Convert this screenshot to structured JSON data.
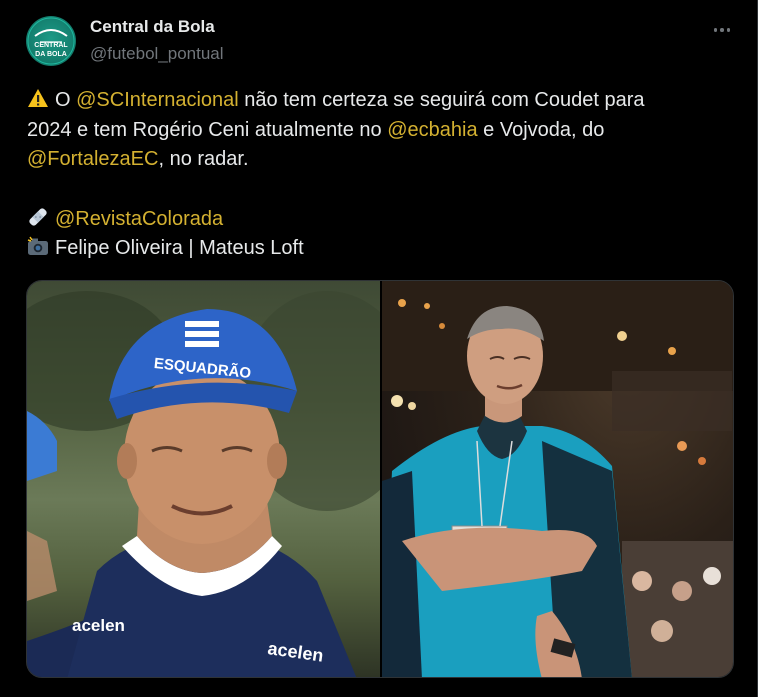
{
  "author": {
    "name": "Central da Bola",
    "handle": "@futebol_pontual",
    "avatar_text_1": "CENTRAL",
    "avatar_text_2": "DA BOLA"
  },
  "tweet": {
    "line1": {
      "emoji": "warning-icon",
      "t1": "O ",
      "m1": "@SCInternacional",
      "t2": " não tem certeza se seguirá com Coudet para"
    },
    "line2": {
      "t1": "2024 e tem Rogério Ceni atualmente no ",
      "m1": "@ecbahia",
      "t2": " e Vojvoda, do"
    },
    "line3": {
      "m1": "@FortalezaEC",
      "t1": ", no radar."
    },
    "line4": {
      "emoji": "bandage-icon",
      "m1": "@RevistaColorada"
    },
    "line5": {
      "emoji": "camera-flash-icon",
      "t1": "Felipe Oliveira | Mateus Loft"
    }
  },
  "media": {
    "left_cap_text": "ESQUADRÃO",
    "left_sponsor_1": "acelen",
    "left_sponsor_2": "acelen"
  },
  "colors": {
    "mention": "#d4b131",
    "text": "#e7e9ea",
    "muted": "#71767b",
    "bg": "#000000"
  }
}
